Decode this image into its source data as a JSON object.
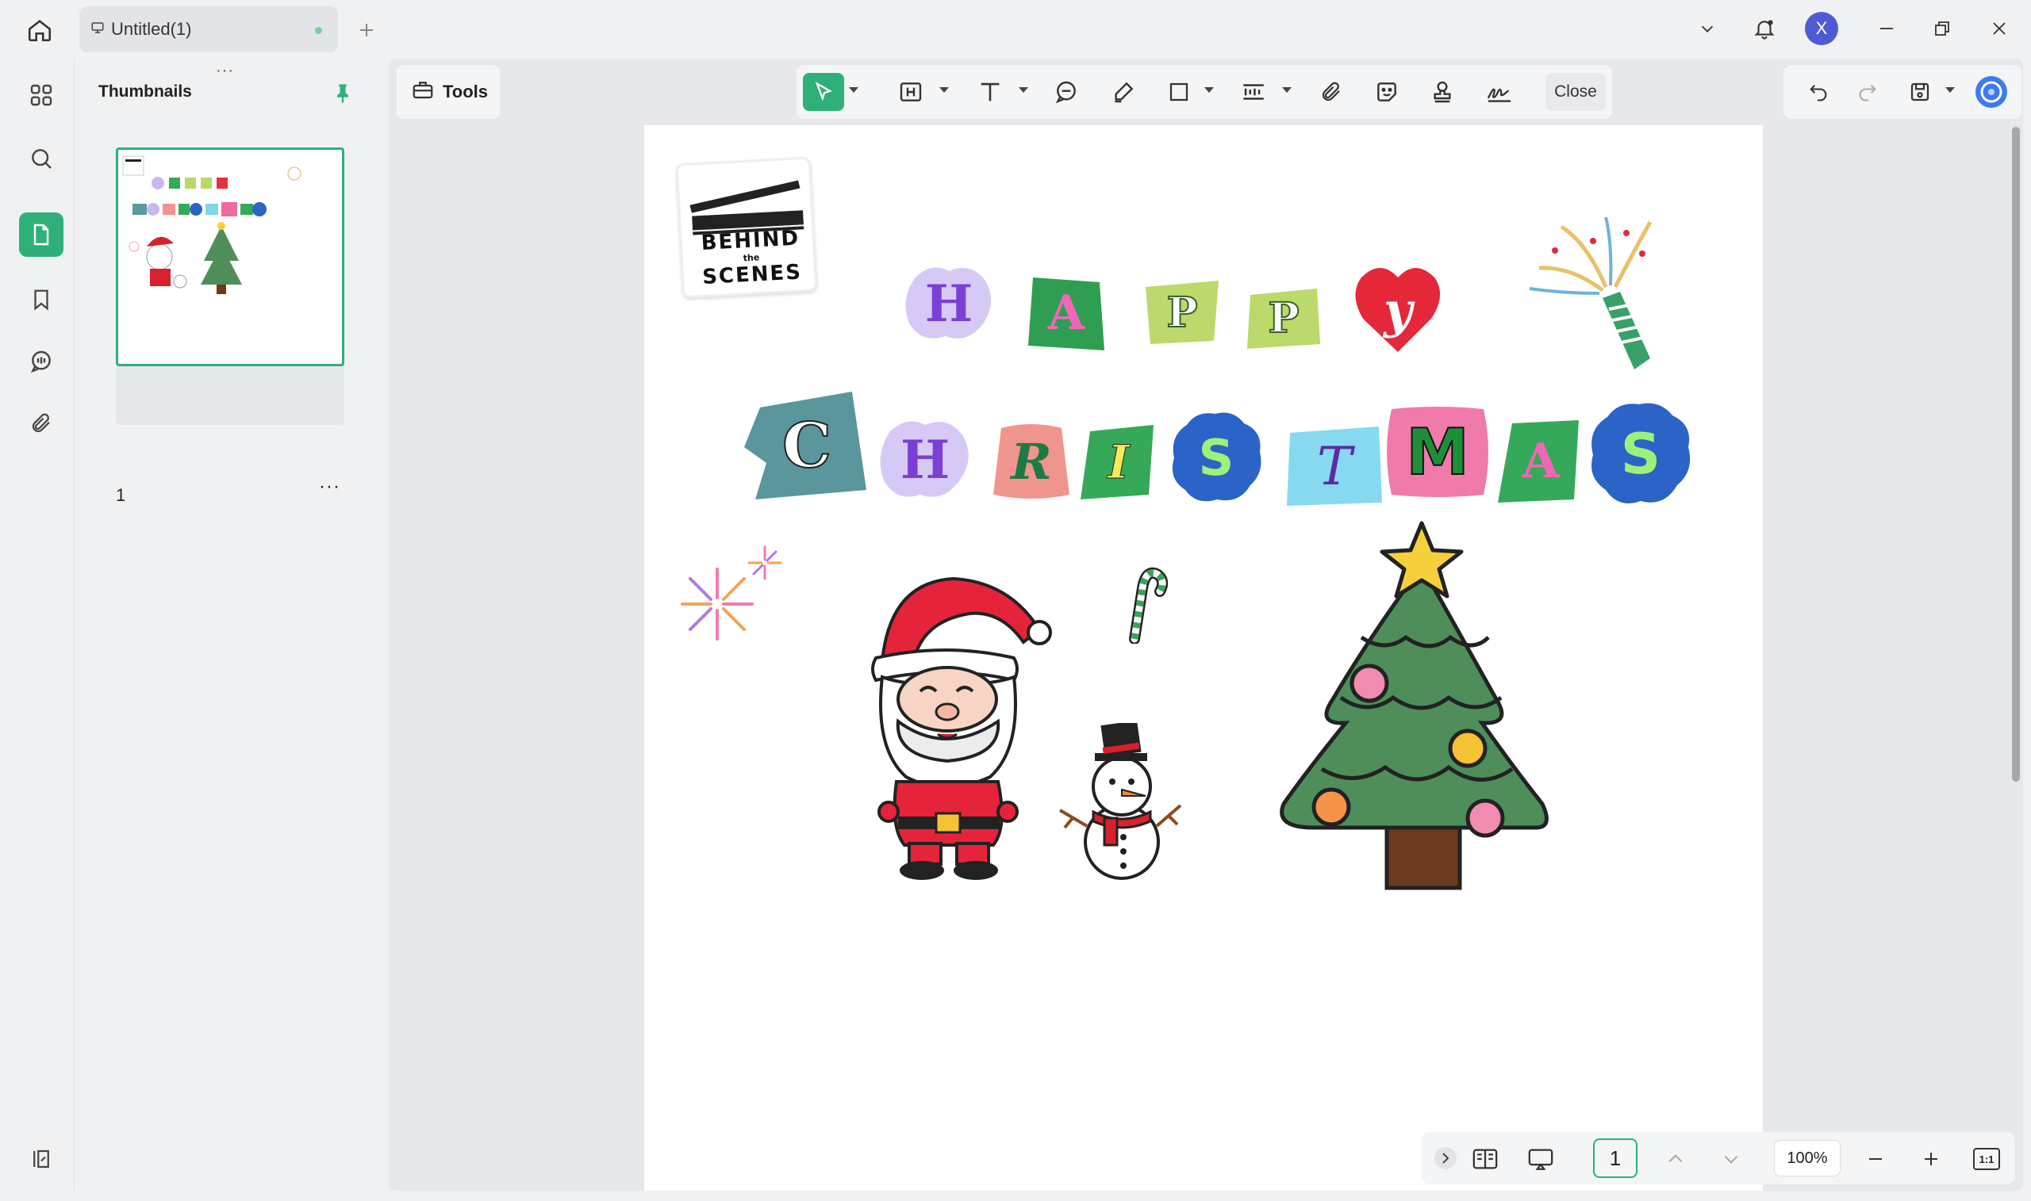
{
  "window": {
    "tab_title": "Untitled(1)",
    "avatar_initial": "X"
  },
  "sidebar": {
    "panel_title": "Thumbnails",
    "page_number": "1",
    "more": "···",
    "grip": "···"
  },
  "toolbar": {
    "tools_label": "Tools",
    "close_label": "Close"
  },
  "document": {
    "clapper_line1": "BEHIND",
    "clapper_line2": "the",
    "clapper_line3": "SCENES",
    "row1_letters": [
      "H",
      "A",
      "P",
      "P",
      "y"
    ],
    "row2_letters": [
      "C",
      "H",
      "R",
      "I",
      "S",
      "T",
      "M",
      "A",
      "S"
    ]
  },
  "navigation": {
    "current_page": "1",
    "zoom": "100%",
    "fit_label": "1:1"
  },
  "colors": {
    "accent": "#2fb07a",
    "avatar": "#4f5bd5"
  }
}
